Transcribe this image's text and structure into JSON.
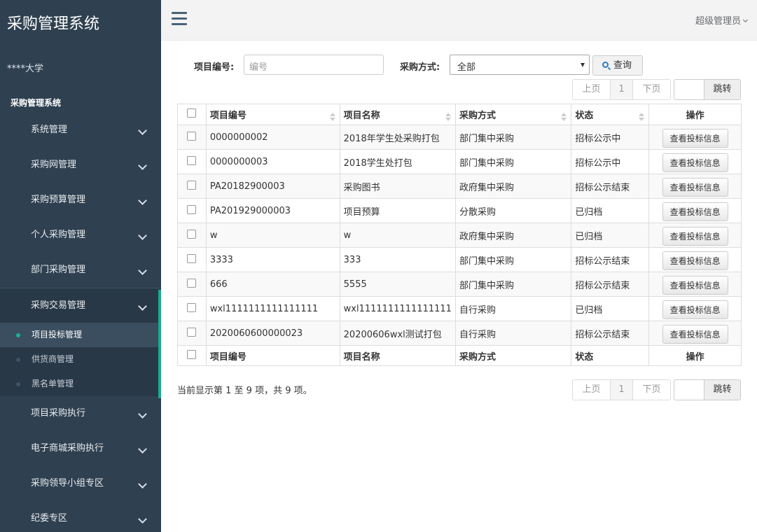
{
  "app": {
    "title": "采购管理系统",
    "org": "****大学",
    "section": "采购管理系统"
  },
  "sidebar": {
    "items_top": [
      {
        "label": "系统管理"
      },
      {
        "label": "采购网管理"
      },
      {
        "label": "采购预算管理"
      },
      {
        "label": "个人采购管理"
      },
      {
        "label": "部门采购管理"
      }
    ],
    "active": {
      "label": "采购交易管理"
    },
    "sub_items": [
      {
        "label": "项目投标管理"
      },
      {
        "label": "供货商管理"
      },
      {
        "label": "黑名单管理"
      }
    ],
    "items_bottom": [
      {
        "label": "项目采购执行"
      },
      {
        "label": "电子商城采购执行"
      },
      {
        "label": "采购领导小组专区"
      },
      {
        "label": "纪委专区"
      }
    ]
  },
  "topbar": {
    "user": "超级管理员"
  },
  "filters": {
    "project_no_label": "项目编号:",
    "project_no_placeholder": "编号",
    "method_label": "采购方式:",
    "method_value": "全部",
    "query_button": "查询"
  },
  "pager": {
    "prev": "上页",
    "page": "1",
    "next": "下页",
    "jump": "跳转"
  },
  "table": {
    "headers": [
      "项目编号",
      "项目名称",
      "采购方式",
      "状态",
      "操作"
    ],
    "action_label": "查看投标信息",
    "rows": [
      [
        "0000000002",
        "2018年学生处采购打包",
        "部门集中采购",
        "招标公示中"
      ],
      [
        "0000000003",
        "2018学生处打包",
        "部门集中采购",
        "招标公示中"
      ],
      [
        "PA20182900003",
        "采购图书",
        "政府集中采购",
        "招标公示结束"
      ],
      [
        "PA201929000003",
        "项目预算",
        "分散采购",
        "已归档"
      ],
      [
        "w",
        "w",
        "政府集中采购",
        "已归档"
      ],
      [
        "3333",
        "333",
        "部门集中采购",
        "招标公示结束"
      ],
      [
        "666",
        "5555",
        "部门集中采购",
        "招标公示结束"
      ],
      [
        "wxl1111111111111111",
        "wxl1111111111111111",
        "自行采购",
        "已归档"
      ],
      [
        "2020060600000023",
        "20200606wxl测试打包",
        "自行采购",
        "招标公示结束"
      ]
    ]
  },
  "summary": "当前显示第 1 至 9 项，共 9 项。"
}
